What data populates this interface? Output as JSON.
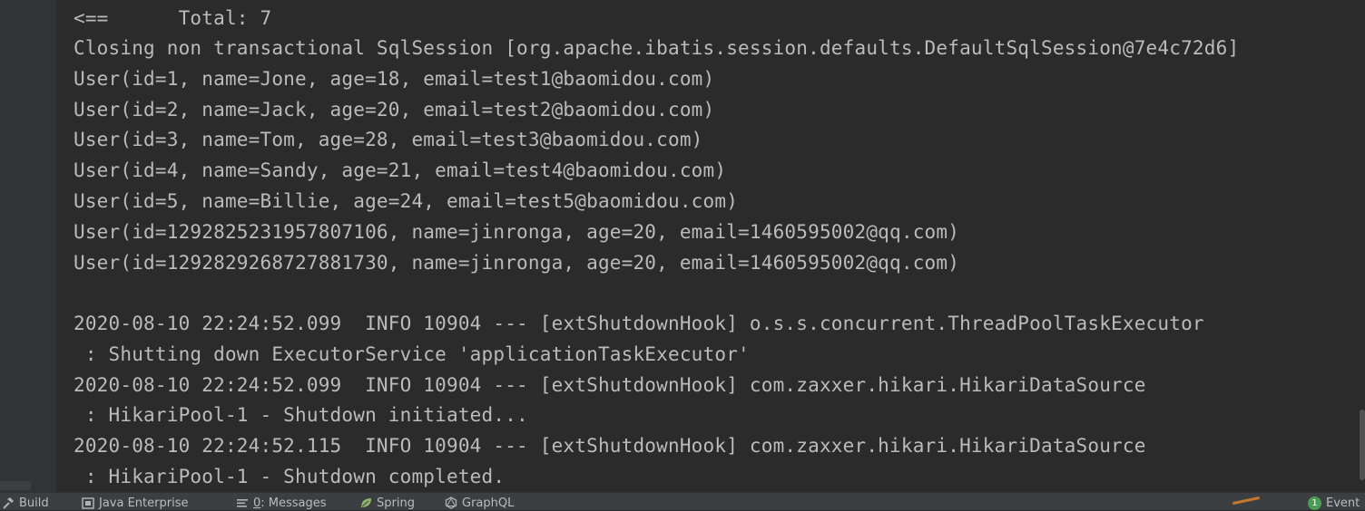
{
  "console": {
    "lines": [
      "<==      Total: 7",
      "Closing non transactional SqlSession [org.apache.ibatis.session.defaults.DefaultSqlSession@7e4c72d6]",
      "User(id=1, name=Jone, age=18, email=test1@baomidou.com)",
      "User(id=2, name=Jack, age=20, email=test2@baomidou.com)",
      "User(id=3, name=Tom, age=28, email=test3@baomidou.com)",
      "User(id=4, name=Sandy, age=21, email=test4@baomidou.com)",
      "User(id=5, name=Billie, age=24, email=test5@baomidou.com)",
      "User(id=1292825231957807106, name=jinronga, age=20, email=1460595002@qq.com)",
      "User(id=1292829268727881730, name=jinronga, age=20, email=1460595002@qq.com)",
      "",
      "2020-08-10 22:24:52.099  INFO 10904 --- [extShutdownHook] o.s.s.concurrent.ThreadPoolTaskExecutor",
      " : Shutting down ExecutorService 'applicationTaskExecutor'",
      "2020-08-10 22:24:52.099  INFO 10904 --- [extShutdownHook] com.zaxxer.hikari.HikariDataSource",
      " : HikariPool-1 - Shutdown initiated...",
      "2020-08-10 22:24:52.115  INFO 10904 --- [extShutdownHook] com.zaxxer.hikari.HikariDataSource",
      " : HikariPool-1 - Shutdown completed."
    ]
  },
  "statusbar": {
    "build": "Build",
    "java_enterprise": "Java Enterprise",
    "messages_prefix": "0",
    "messages_suffix": ": Messages",
    "spring": "Spring",
    "graphql": "GraphQL",
    "event_count": "1",
    "event_label": "Event",
    "icons": {
      "build": "hammer-icon",
      "java_enterprise": "java-enterprise-icon",
      "messages": "messages-icon",
      "spring": "spring-leaf-icon",
      "graphql": "graphql-icon"
    },
    "colors": {
      "event_badge": "#499c54",
      "spring_leaf": "#8fb36b"
    }
  }
}
